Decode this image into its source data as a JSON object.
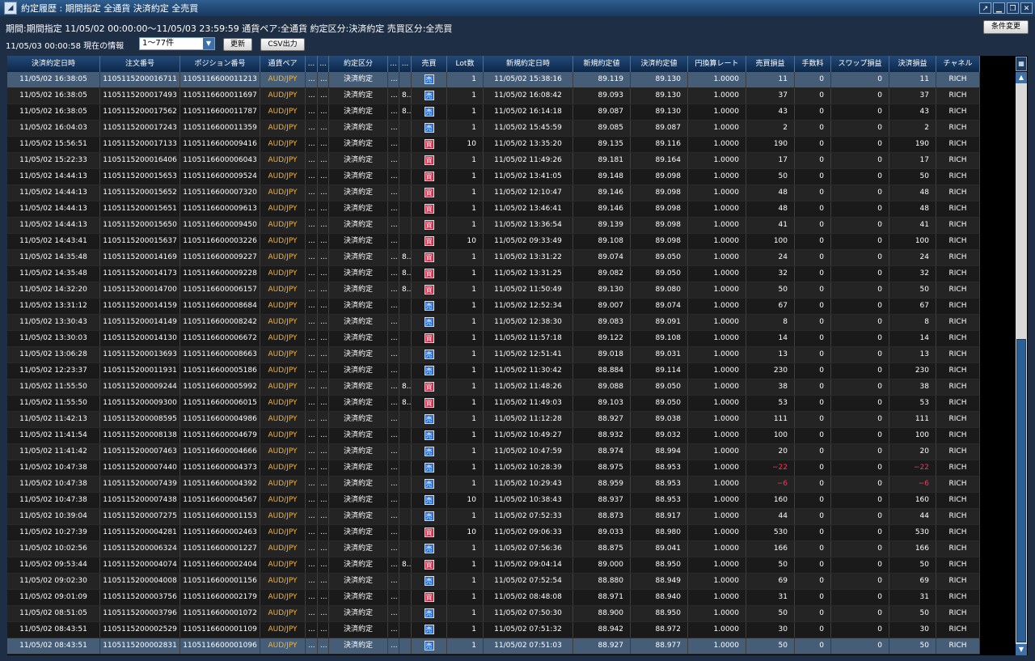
{
  "window": {
    "title": "約定履歴 : 期間指定 全通貨 決済約定 全売買",
    "app_icon": "app-logo-icon"
  },
  "filters": {
    "line1": "期間:期間指定  11/05/02 00:00:00～11/05/03 23:59:59   通貨ペア:全通貨   約定区分:決済約定   売買区分:全売買",
    "info_time": "11/05/03 00:00:58 現在の情報",
    "range_value": "1～77件"
  },
  "buttons": {
    "refresh": "更新",
    "csv": "CSV出力",
    "change_conditions": "条件変更"
  },
  "columns": [
    "決済約定日時",
    "注文番号",
    "ポジション番号",
    "通貨ペア",
    "...",
    "...",
    "約定区分",
    "...",
    "...",
    "売買",
    "Lot数",
    "新規約定日時",
    "新規約定値",
    "決済約定値",
    "円換算レート",
    "売買損益",
    "手数料",
    "スワップ損益",
    "決済損益",
    "チャネル"
  ],
  "side_labels": {
    "sell": "売",
    "buy": "買"
  },
  "rows": [
    [
      "11/05/02 16:38:05",
      "1105115200016711",
      "1105116600011213",
      "AUD/JPY",
      "...",
      "...",
      "決済約定",
      "...",
      "",
      "sell",
      "1",
      "11/05/02 15:38:16",
      "89.119",
      "89.130",
      "1.0000",
      "11",
      "0",
      "0",
      "11",
      "RICH"
    ],
    [
      "11/05/02 16:38:05",
      "1105115200017493",
      "1105116600011697",
      "AUD/JPY",
      "...",
      "...",
      "決済約定",
      "...",
      "8...",
      "sell",
      "1",
      "11/05/02 16:08:42",
      "89.093",
      "89.130",
      "1.0000",
      "37",
      "0",
      "0",
      "37",
      "RICH"
    ],
    [
      "11/05/02 16:38:05",
      "1105115200017562",
      "1105116600011787",
      "AUD/JPY",
      "...",
      "...",
      "決済約定",
      "...",
      "8...",
      "sell",
      "1",
      "11/05/02 16:14:18",
      "89.087",
      "89.130",
      "1.0000",
      "43",
      "0",
      "0",
      "43",
      "RICH"
    ],
    [
      "11/05/02 16:04:03",
      "1105115200017243",
      "1105116600011359",
      "AUD/JPY",
      "...",
      "...",
      "決済約定",
      "...",
      "",
      "sell",
      "1",
      "11/05/02 15:45:59",
      "89.085",
      "89.087",
      "1.0000",
      "2",
      "0",
      "0",
      "2",
      "RICH"
    ],
    [
      "11/05/02 15:56:51",
      "1105115200017133",
      "1105116600009416",
      "AUD/JPY",
      "...",
      "...",
      "決済約定",
      "...",
      "",
      "buy",
      "10",
      "11/05/02 13:35:20",
      "89.135",
      "89.116",
      "1.0000",
      "190",
      "0",
      "0",
      "190",
      "RICH"
    ],
    [
      "11/05/02 15:22:33",
      "1105115200016406",
      "1105116600006043",
      "AUD/JPY",
      "...",
      "...",
      "決済約定",
      "...",
      "",
      "buy",
      "1",
      "11/05/02 11:49:26",
      "89.181",
      "89.164",
      "1.0000",
      "17",
      "0",
      "0",
      "17",
      "RICH"
    ],
    [
      "11/05/02 14:44:13",
      "1105115200015653",
      "1105116600009524",
      "AUD/JPY",
      "...",
      "...",
      "決済約定",
      "...",
      "",
      "buy",
      "1",
      "11/05/02 13:41:05",
      "89.148",
      "89.098",
      "1.0000",
      "50",
      "0",
      "0",
      "50",
      "RICH"
    ],
    [
      "11/05/02 14:44:13",
      "1105115200015652",
      "1105116600007320",
      "AUD/JPY",
      "...",
      "...",
      "決済約定",
      "...",
      "",
      "buy",
      "1",
      "11/05/02 12:10:47",
      "89.146",
      "89.098",
      "1.0000",
      "48",
      "0",
      "0",
      "48",
      "RICH"
    ],
    [
      "11/05/02 14:44:13",
      "1105115200015651",
      "1105116600009613",
      "AUD/JPY",
      "...",
      "...",
      "決済約定",
      "...",
      "",
      "buy",
      "1",
      "11/05/02 13:46:41",
      "89.146",
      "89.098",
      "1.0000",
      "48",
      "0",
      "0",
      "48",
      "RICH"
    ],
    [
      "11/05/02 14:44:13",
      "1105115200015650",
      "1105116600009450",
      "AUD/JPY",
      "...",
      "...",
      "決済約定",
      "...",
      "",
      "buy",
      "1",
      "11/05/02 13:36:54",
      "89.139",
      "89.098",
      "1.0000",
      "41",
      "0",
      "0",
      "41",
      "RICH"
    ],
    [
      "11/05/02 14:43:41",
      "1105115200015637",
      "1105116600003226",
      "AUD/JPY",
      "...",
      "...",
      "決済約定",
      "...",
      "",
      "buy",
      "10",
      "11/05/02 09:33:49",
      "89.108",
      "89.098",
      "1.0000",
      "100",
      "0",
      "0",
      "100",
      "RICH"
    ],
    [
      "11/05/02 14:35:48",
      "1105115200014169",
      "1105116600009227",
      "AUD/JPY",
      "...",
      "...",
      "決済約定",
      "...",
      "8...",
      "buy",
      "1",
      "11/05/02 13:31:22",
      "89.074",
      "89.050",
      "1.0000",
      "24",
      "0",
      "0",
      "24",
      "RICH"
    ],
    [
      "11/05/02 14:35:48",
      "1105115200014173",
      "1105116600009228",
      "AUD/JPY",
      "...",
      "...",
      "決済約定",
      "...",
      "8...",
      "buy",
      "1",
      "11/05/02 13:31:25",
      "89.082",
      "89.050",
      "1.0000",
      "32",
      "0",
      "0",
      "32",
      "RICH"
    ],
    [
      "11/05/02 14:32:20",
      "1105115200014700",
      "1105116600006157",
      "AUD/JPY",
      "...",
      "...",
      "決済約定",
      "...",
      "8...",
      "buy",
      "1",
      "11/05/02 11:50:49",
      "89.130",
      "89.080",
      "1.0000",
      "50",
      "0",
      "0",
      "50",
      "RICH"
    ],
    [
      "11/05/02 13:31:12",
      "1105115200014159",
      "1105116600008684",
      "AUD/JPY",
      "...",
      "...",
      "決済約定",
      "...",
      "",
      "sell",
      "1",
      "11/05/02 12:52:34",
      "89.007",
      "89.074",
      "1.0000",
      "67",
      "0",
      "0",
      "67",
      "RICH"
    ],
    [
      "11/05/02 13:30:43",
      "1105115200014149",
      "1105116600008242",
      "AUD/JPY",
      "...",
      "...",
      "決済約定",
      "...",
      "",
      "sell",
      "1",
      "11/05/02 12:38:30",
      "89.083",
      "89.091",
      "1.0000",
      "8",
      "0",
      "0",
      "8",
      "RICH"
    ],
    [
      "11/05/02 13:30:03",
      "1105115200014130",
      "1105116600006672",
      "AUD/JPY",
      "...",
      "...",
      "決済約定",
      "...",
      "",
      "buy",
      "1",
      "11/05/02 11:57:18",
      "89.122",
      "89.108",
      "1.0000",
      "14",
      "0",
      "0",
      "14",
      "RICH"
    ],
    [
      "11/05/02 13:06:28",
      "1105115200013693",
      "1105116600008663",
      "AUD/JPY",
      "...",
      "...",
      "決済約定",
      "...",
      "",
      "sell",
      "1",
      "11/05/02 12:51:41",
      "89.018",
      "89.031",
      "1.0000",
      "13",
      "0",
      "0",
      "13",
      "RICH"
    ],
    [
      "11/05/02 12:23:37",
      "1105115200011931",
      "1105116600005186",
      "AUD/JPY",
      "...",
      "...",
      "決済約定",
      "...",
      "",
      "sell",
      "1",
      "11/05/02 11:30:42",
      "88.884",
      "89.114",
      "1.0000",
      "230",
      "0",
      "0",
      "230",
      "RICH"
    ],
    [
      "11/05/02 11:55:50",
      "1105115200009244",
      "1105116600005992",
      "AUD/JPY",
      "...",
      "...",
      "決済約定",
      "...",
      "8...",
      "buy",
      "1",
      "11/05/02 11:48:26",
      "89.088",
      "89.050",
      "1.0000",
      "38",
      "0",
      "0",
      "38",
      "RICH"
    ],
    [
      "11/05/02 11:55:50",
      "1105115200009300",
      "1105116600006015",
      "AUD/JPY",
      "...",
      "...",
      "決済約定",
      "...",
      "8...",
      "buy",
      "1",
      "11/05/02 11:49:03",
      "89.103",
      "89.050",
      "1.0000",
      "53",
      "0",
      "0",
      "53",
      "RICH"
    ],
    [
      "11/05/02 11:42:13",
      "1105115200008595",
      "1105116600004986",
      "AUD/JPY",
      "...",
      "...",
      "決済約定",
      "...",
      "",
      "sell",
      "1",
      "11/05/02 11:12:28",
      "88.927",
      "89.038",
      "1.0000",
      "111",
      "0",
      "0",
      "111",
      "RICH"
    ],
    [
      "11/05/02 11:41:54",
      "1105115200008138",
      "1105116600004679",
      "AUD/JPY",
      "...",
      "...",
      "決済約定",
      "...",
      "",
      "sell",
      "1",
      "11/05/02 10:49:27",
      "88.932",
      "89.032",
      "1.0000",
      "100",
      "0",
      "0",
      "100",
      "RICH"
    ],
    [
      "11/05/02 11:41:42",
      "1105115200007463",
      "1105116600004666",
      "AUD/JPY",
      "...",
      "...",
      "決済約定",
      "...",
      "",
      "sell",
      "1",
      "11/05/02 10:47:59",
      "88.974",
      "88.994",
      "1.0000",
      "20",
      "0",
      "0",
      "20",
      "RICH"
    ],
    [
      "11/05/02 10:47:38",
      "1105115200007440",
      "1105116600004373",
      "AUD/JPY",
      "...",
      "...",
      "決済約定",
      "...",
      "",
      "sell",
      "1",
      "11/05/02 10:28:39",
      "88.975",
      "88.953",
      "1.0000",
      "−22",
      "0",
      "0",
      "−22",
      "RICH"
    ],
    [
      "11/05/02 10:47:38",
      "1105115200007439",
      "1105116600004392",
      "AUD/JPY",
      "...",
      "...",
      "決済約定",
      "...",
      "",
      "sell",
      "1",
      "11/05/02 10:29:43",
      "88.959",
      "88.953",
      "1.0000",
      "−6",
      "0",
      "0",
      "−6",
      "RICH"
    ],
    [
      "11/05/02 10:47:38",
      "1105115200007438",
      "1105116600004567",
      "AUD/JPY",
      "...",
      "...",
      "決済約定",
      "...",
      "",
      "sell",
      "10",
      "11/05/02 10:38:43",
      "88.937",
      "88.953",
      "1.0000",
      "160",
      "0",
      "0",
      "160",
      "RICH"
    ],
    [
      "11/05/02 10:39:04",
      "1105115200007275",
      "1105116600001153",
      "AUD/JPY",
      "...",
      "...",
      "決済約定",
      "...",
      "",
      "sell",
      "1",
      "11/05/02 07:52:33",
      "88.873",
      "88.917",
      "1.0000",
      "44",
      "0",
      "0",
      "44",
      "RICH"
    ],
    [
      "11/05/02 10:27:39",
      "1105115200004281",
      "1105116600002463",
      "AUD/JPY",
      "...",
      "...",
      "決済約定",
      "...",
      "",
      "buy",
      "10",
      "11/05/02 09:06:33",
      "89.033",
      "88.980",
      "1.0000",
      "530",
      "0",
      "0",
      "530",
      "RICH"
    ],
    [
      "11/05/02 10:02:56",
      "1105115200006324",
      "1105116600001227",
      "AUD/JPY",
      "...",
      "...",
      "決済約定",
      "...",
      "",
      "sell",
      "1",
      "11/05/02 07:56:36",
      "88.875",
      "89.041",
      "1.0000",
      "166",
      "0",
      "0",
      "166",
      "RICH"
    ],
    [
      "11/05/02 09:53:44",
      "1105115200004074",
      "1105116600002404",
      "AUD/JPY",
      "...",
      "...",
      "決済約定",
      "...",
      "8...",
      "buy",
      "1",
      "11/05/02 09:04:14",
      "89.000",
      "88.950",
      "1.0000",
      "50",
      "0",
      "0",
      "50",
      "RICH"
    ],
    [
      "11/05/02 09:02:30",
      "1105115200004008",
      "1105116600001156",
      "AUD/JPY",
      "...",
      "...",
      "決済約定",
      "...",
      "",
      "sell",
      "1",
      "11/05/02 07:52:54",
      "88.880",
      "88.949",
      "1.0000",
      "69",
      "0",
      "0",
      "69",
      "RICH"
    ],
    [
      "11/05/02 09:01:09",
      "1105115200003756",
      "1105116600002179",
      "AUD/JPY",
      "...",
      "...",
      "決済約定",
      "...",
      "",
      "buy",
      "1",
      "11/05/02 08:48:08",
      "88.971",
      "88.940",
      "1.0000",
      "31",
      "0",
      "0",
      "31",
      "RICH"
    ],
    [
      "11/05/02 08:51:05",
      "1105115200003796",
      "1105116600001072",
      "AUD/JPY",
      "...",
      "...",
      "決済約定",
      "...",
      "",
      "sell",
      "1",
      "11/05/02 07:50:30",
      "88.900",
      "88.950",
      "1.0000",
      "50",
      "0",
      "0",
      "50",
      "RICH"
    ],
    [
      "11/05/02 08:43:51",
      "1105115200002529",
      "1105116600001109",
      "AUD/JPY",
      "...",
      "...",
      "決済約定",
      "...",
      "",
      "sell",
      "1",
      "11/05/02 07:51:32",
      "88.942",
      "88.972",
      "1.0000",
      "30",
      "0",
      "0",
      "30",
      "RICH"
    ],
    [
      "11/05/02 08:43:51",
      "1105115200002831",
      "1105116600001096",
      "AUD/JPY",
      "...",
      "...",
      "決済約定",
      "...",
      "",
      "sell",
      "1",
      "11/05/02 07:51:03",
      "88.927",
      "88.977",
      "1.0000",
      "50",
      "0",
      "0",
      "50",
      "RICH"
    ]
  ],
  "colors": {
    "pair": "#f2b33d",
    "negative": "#ff3355",
    "sell_badge": "#2a6fd6",
    "buy_badge": "#d62b4a",
    "header": "#173a62"
  }
}
